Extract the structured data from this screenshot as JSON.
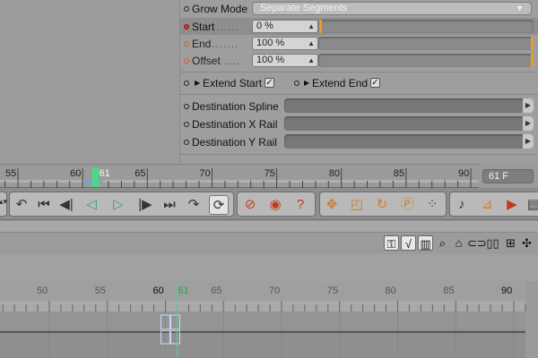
{
  "attributes": {
    "grow_mode": {
      "label": "Grow Mode",
      "value": "Separate Segments"
    },
    "start": {
      "label": "Start",
      "value": "0 %"
    },
    "end": {
      "label": "End",
      "value": "100 %"
    },
    "offset": {
      "label": "Offset",
      "value": "100 %"
    },
    "extend_start": {
      "label": "Extend Start",
      "checked": true
    },
    "extend_end": {
      "label": "Extend End",
      "checked": true
    },
    "dest_spline": {
      "label": "Destination Spline"
    },
    "dest_x_rail": {
      "label": "Destination X Rail"
    },
    "dest_y_rail": {
      "label": "Destination Y Rail"
    },
    "slider_fill": {
      "start": 0.0,
      "end": 1.0,
      "offset": 1.0
    }
  },
  "ruler": {
    "ticks": [
      55,
      60,
      61,
      65,
      70,
      75,
      80,
      85,
      90
    ],
    "current_frame": 61,
    "frame_display": "61 F"
  },
  "timeline": {
    "ticks": [
      50,
      55,
      60,
      61,
      65,
      70,
      75,
      80,
      85,
      90
    ],
    "current_frame": 61
  },
  "icons": {
    "toolbar": [
      "goto-start-arrow-icon",
      "first-frame-icon",
      "prev-key-icon",
      "play-backward-icon",
      "play-forward-icon",
      "next-key-icon",
      "last-frame-icon",
      "goto-end-arrow-icon",
      "loop-icon",
      "record-key-icon",
      "autokey-icon",
      "help-question-icon",
      "move-tool-icon",
      "scale-tool-icon",
      "rotate-tool-icon",
      "param-tool-icon",
      "grid-dots-icon",
      "sound-icon",
      "animation-graph-icon",
      "render-icon",
      "docs-icon"
    ],
    "timeline": [
      "key-mode-icon",
      "fcurve-mode-icon",
      "motion-mode-icon",
      "search-icon",
      "home-icon",
      "link-icon",
      "layer-icon",
      "add-icon",
      "move-icon"
    ]
  },
  "colors": {
    "accent_orange": "#e89c2c",
    "playhead_green": "#4fd48a",
    "record_red": "#d23a1a"
  }
}
